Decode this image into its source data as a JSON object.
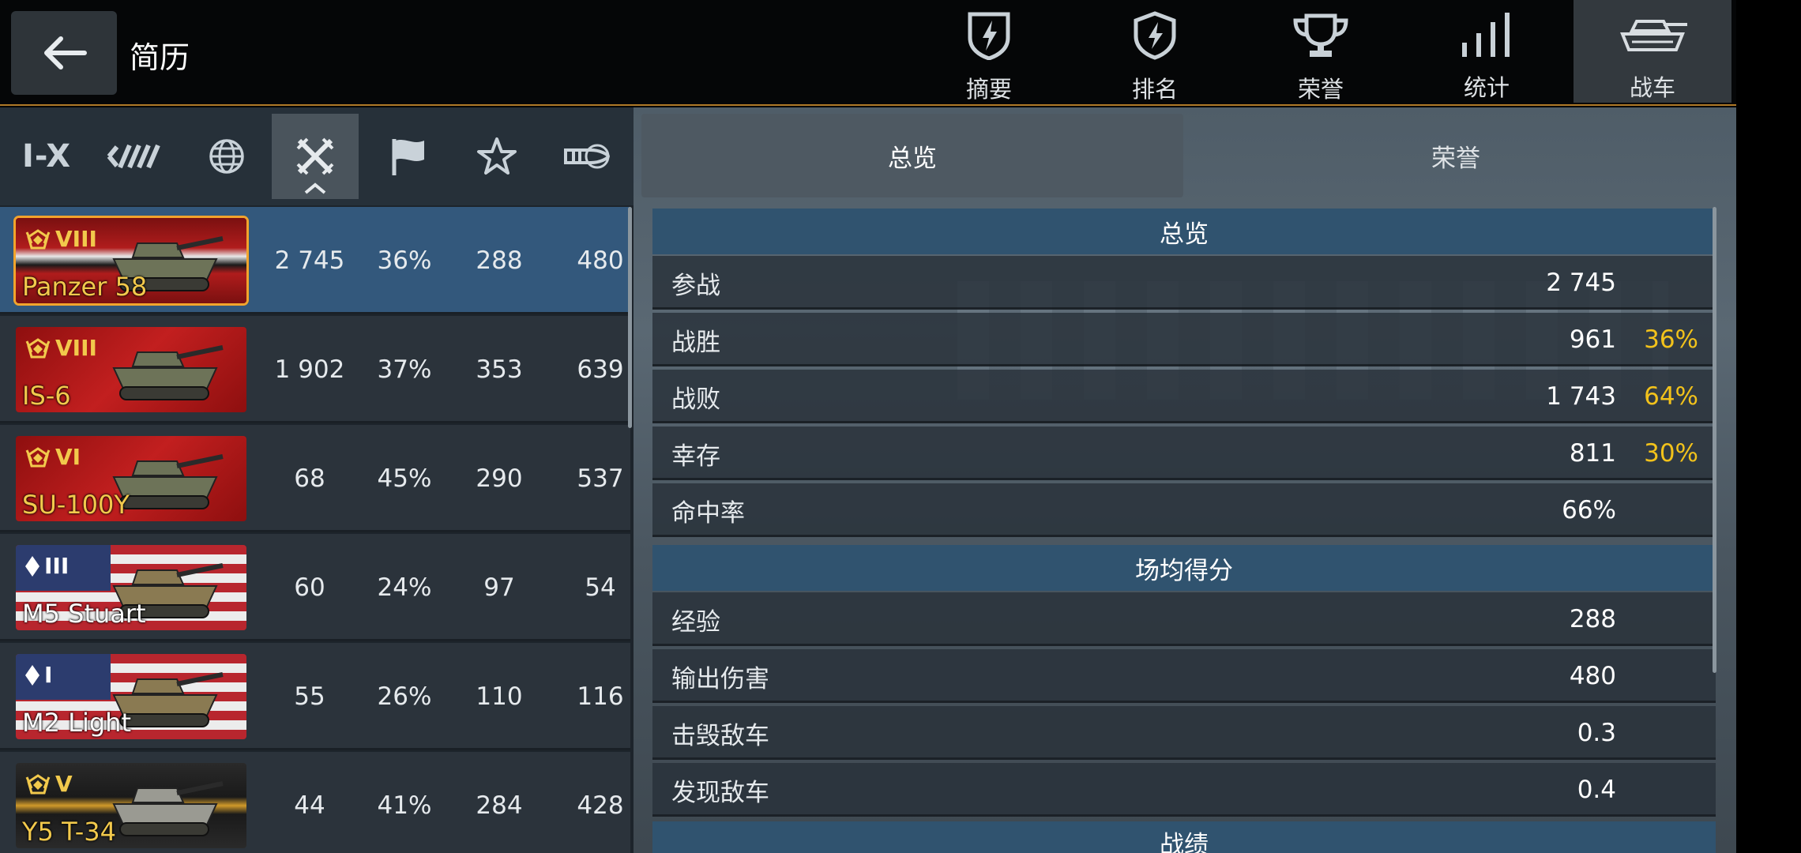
{
  "header": {
    "title": "简历",
    "tabs": [
      {
        "label": "摘要",
        "icon": "shield-bolt-icon"
      },
      {
        "label": "排名",
        "icon": "shield-lightning-icon"
      },
      {
        "label": "荣誉",
        "icon": "trophy-icon"
      },
      {
        "label": "统计",
        "icon": "bar-chart-icon"
      },
      {
        "label": "战车",
        "icon": "tank-icon",
        "active": true
      }
    ]
  },
  "filters": {
    "tier_label": "I-X",
    "active": "battles-sort",
    "items": [
      "tier-filter",
      "vehicle-class-filter",
      "nation-filter",
      "battles-sort",
      "wins-sort",
      "experience-sort",
      "damage-sort"
    ]
  },
  "vehicles": [
    {
      "name": "Panzer 58",
      "tier": "VIII",
      "mastery": "mastery-badge",
      "nation": "germany",
      "battles": "2 745",
      "winrate": "36%",
      "exp": "288",
      "damage": "480",
      "selected": true
    },
    {
      "name": "IS-6",
      "tier": "VIII",
      "mastery": "mastery-badge",
      "nation": "ussr",
      "battles": "1 902",
      "winrate": "37%",
      "exp": "353",
      "damage": "639"
    },
    {
      "name": "SU-100Y",
      "tier": "VI",
      "mastery": "mastery-badge",
      "nation": "ussr",
      "battles": "68",
      "winrate": "45%",
      "exp": "290",
      "damage": "537"
    },
    {
      "name": "M5 Stuart",
      "tier": "III",
      "mastery": "class-badge",
      "nation": "usa",
      "battles": "60",
      "winrate": "24%",
      "exp": "97",
      "damage": "54"
    },
    {
      "name": "M2 Light",
      "tier": "I",
      "mastery": "class-badge",
      "nation": "usa",
      "battles": "55",
      "winrate": "26%",
      "exp": "110",
      "damage": "116"
    },
    {
      "name": "Y5 T-34",
      "tier": "V",
      "mastery": "mastery-badge",
      "nation": "china",
      "battles": "44",
      "winrate": "41%",
      "exp": "284",
      "damage": "428"
    }
  ],
  "detail_tabs": [
    {
      "label": "总览",
      "active": true
    },
    {
      "label": "荣誉"
    }
  ],
  "overview": {
    "section1": "总览",
    "rows1": [
      {
        "label": "参战",
        "value": "2 745",
        "pct": ""
      },
      {
        "label": "战胜",
        "value": "961",
        "pct": "36%"
      },
      {
        "label": "战败",
        "value": "1 743",
        "pct": "64%"
      },
      {
        "label": "幸存",
        "value": "811",
        "pct": "30%"
      },
      {
        "label": "命中率",
        "value": "66%",
        "pct": ""
      }
    ],
    "section2": "场均得分",
    "rows2": [
      {
        "label": "经验",
        "value": "288"
      },
      {
        "label": "输出伤害",
        "value": "480"
      },
      {
        "label": "击毁敌车",
        "value": "0.3"
      },
      {
        "label": "发现敌车",
        "value": "0.4"
      }
    ],
    "section3": "战绩"
  },
  "colors": {
    "accent_gold": "#f2c21b",
    "selected_row": "#33587c",
    "section_header": "#30536f"
  }
}
